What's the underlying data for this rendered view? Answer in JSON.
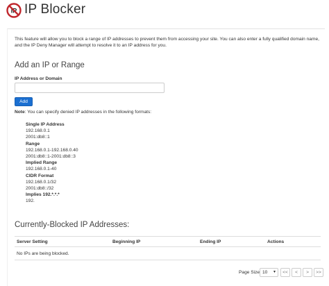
{
  "header": {
    "title": "IP Blocker",
    "logo_icon": "ip-blocker-logo-icon",
    "logo_color": "#c0272d"
  },
  "description": "This feature will allow you to block a range of IP addresses to prevent them from accessing your site. You can also enter a fully qualified domain name, and the IP Deny Manager will attempt to resolve it to an IP address for you.",
  "add_section": {
    "heading": "Add an IP or Range",
    "field_label": "IP Address or Domain",
    "field_value": "",
    "add_button": "Add",
    "add_button_color": "#1b6fd1"
  },
  "note": {
    "label": "Note",
    "text": ": You can specify denied IP addresses in the following formats:"
  },
  "formats": [
    {
      "title": "Single IP Address",
      "examples": [
        "192.168.0.1",
        "2001:db8::1"
      ]
    },
    {
      "title": "Range",
      "examples": [
        "192.168.0.1-192.168.0.40",
        "2001:db8::1-2001:db8::3"
      ]
    },
    {
      "title": "Implied Range",
      "examples": [
        "192.168.0.1-40"
      ]
    },
    {
      "title": "CIDR Format",
      "examples": [
        "192.168.0.1/32",
        "2001:db8::/32"
      ]
    },
    {
      "title": "Implies 192.*.*.*",
      "examples": [
        "192."
      ]
    }
  ],
  "blocked_section": {
    "heading": "Currently-Blocked IP Addresses:",
    "columns": [
      "Server Setting",
      "Beginning IP",
      "Ending IP",
      "Actions"
    ],
    "empty_message": "No IPs are being blocked."
  },
  "pagination": {
    "page_size_label": "Page Size",
    "page_size_value": "10",
    "buttons": [
      "<<",
      "<",
      ">",
      ">>"
    ]
  }
}
